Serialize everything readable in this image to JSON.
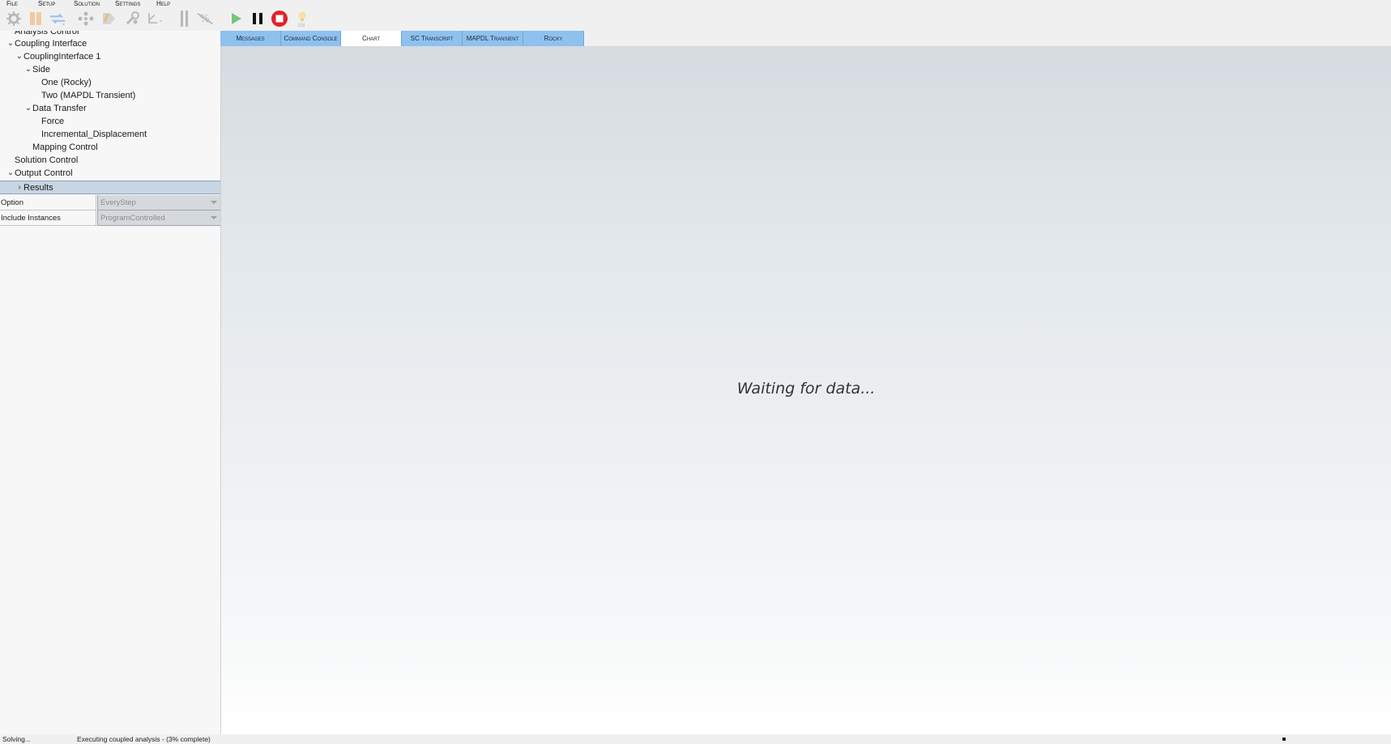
{
  "menu": {
    "items": [
      {
        "id": "file",
        "label": "File"
      },
      {
        "id": "setup",
        "label": "Setup"
      },
      {
        "id": "solution",
        "label": "Solution"
      },
      {
        "id": "settings",
        "label": "Settings"
      },
      {
        "id": "help",
        "label": "Help"
      }
    ]
  },
  "toolbar": {
    "icons": [
      "gear-icon",
      "flag-icon",
      "exchange-icon",
      "nodes-icon",
      "tag-icon",
      "wrench-icon",
      "axis-icon",
      "pipe-icon",
      "no-percent-icon",
      "play-icon",
      "pause-icon",
      "stop-icon",
      "lightbulb-icon"
    ],
    "lightbulb_badge": "EN",
    "colors": {
      "play": "#7cc47c",
      "stop": "#e0212b",
      "disabled": "#b8b8b8"
    }
  },
  "tree": {
    "items": [
      {
        "id": "analysis-control",
        "label": "Analysis Control",
        "level": 1,
        "expanded": null
      },
      {
        "id": "coupling-interface",
        "label": "Coupling Interface",
        "level": 1,
        "expanded": true
      },
      {
        "id": "couplinginterface-1",
        "label": "CouplingInterface 1",
        "level": 2,
        "expanded": true
      },
      {
        "id": "side",
        "label": "Side",
        "level": 3,
        "expanded": true
      },
      {
        "id": "one-rocky",
        "label": "One (Rocky)",
        "level": 4,
        "expanded": null
      },
      {
        "id": "two-mapdl",
        "label": "Two (MAPDL Transient)",
        "level": 4,
        "expanded": null
      },
      {
        "id": "data-transfer",
        "label": "Data Transfer",
        "level": 3,
        "expanded": true
      },
      {
        "id": "force",
        "label": "Force",
        "level": 4,
        "expanded": null
      },
      {
        "id": "incremental-displacement",
        "label": "Incremental_Displacement",
        "level": 4,
        "expanded": null
      },
      {
        "id": "mapping-control",
        "label": "Mapping Control",
        "level": 3,
        "expanded": null
      },
      {
        "id": "solution-control",
        "label": "Solution Control",
        "level": 1,
        "expanded": null
      },
      {
        "id": "output-control",
        "label": "Output Control",
        "level": 1,
        "expanded": true
      },
      {
        "id": "results",
        "label": "Results",
        "level": 2,
        "expanded": false,
        "selected": true
      }
    ]
  },
  "properties": {
    "rows": [
      {
        "name": "Option",
        "value": "EveryStep"
      },
      {
        "name": "Include Instances",
        "value": "ProgramControlled"
      }
    ]
  },
  "tabs": [
    {
      "id": "messages",
      "label": "Messages",
      "active": false
    },
    {
      "id": "command-console",
      "label": "Command Console",
      "active": false
    },
    {
      "id": "chart",
      "label": "Chart",
      "active": true
    },
    {
      "id": "sc-transcript",
      "label": "SC Transcript",
      "active": false
    },
    {
      "id": "mapdl-transient",
      "label": "MAPDL Transient",
      "active": false
    },
    {
      "id": "rocky",
      "label": "Rocky",
      "active": false
    }
  ],
  "chart": {
    "waiting_text": "Waiting for data..."
  },
  "status": {
    "state": "Solving...",
    "message": "Executing coupled analysis - (3% complete)"
  }
}
